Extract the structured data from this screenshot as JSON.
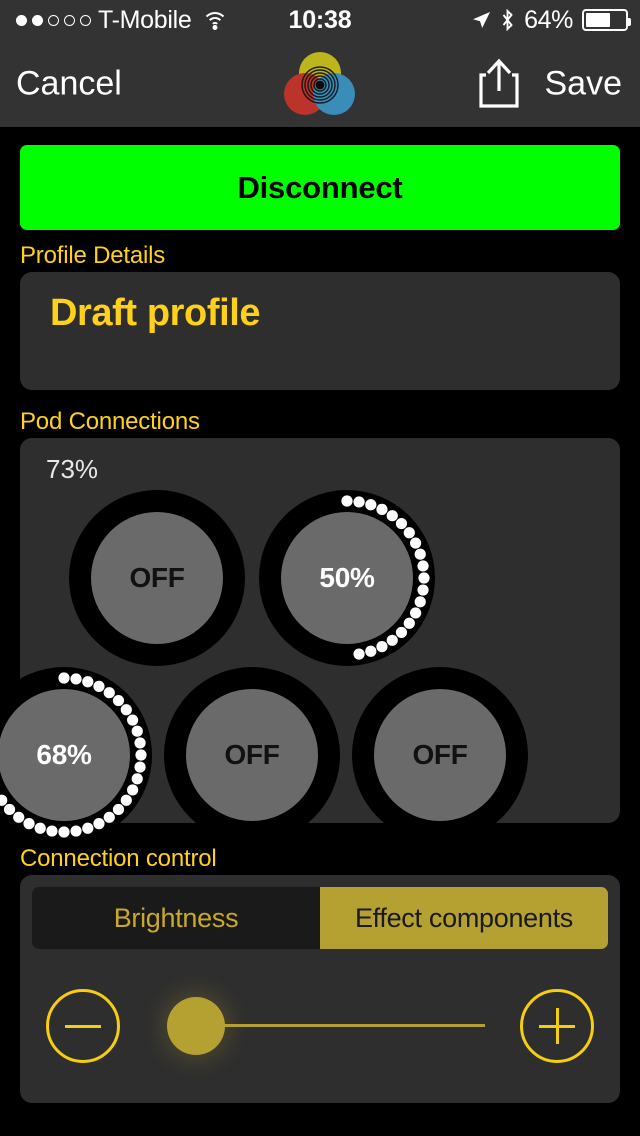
{
  "status_bar": {
    "signal_dots_filled": 2,
    "signal_dots_total": 5,
    "carrier": "T-Mobile",
    "wifi_icon": "wifi-icon",
    "time": "10:38",
    "location_icon": "location-arrow-icon",
    "bluetooth_icon": "bluetooth-icon",
    "battery_percent_label": "64%",
    "battery_level": 64
  },
  "nav": {
    "cancel_label": "Cancel",
    "save_label": "Save",
    "share_icon": "share-icon",
    "logo_icon": "app-logo-icon"
  },
  "main": {
    "disconnect_label": "Disconnect",
    "profile": {
      "section_label": "Profile Details",
      "name": "Draft profile"
    },
    "pods": {
      "section_label": "Pod Connections",
      "overall_percent_label": "73%",
      "dials": [
        {
          "name": "pod-dial-1",
          "label": "OFF",
          "value": 0,
          "on": false,
          "row": 0,
          "col": 0
        },
        {
          "name": "pod-dial-2",
          "label": "50%",
          "value": 50,
          "on": true,
          "row": 0,
          "col": 1
        },
        {
          "name": "pod-dial-3",
          "label": "68%",
          "value": 68,
          "on": true,
          "row": 1,
          "col": 0
        },
        {
          "name": "pod-dial-4",
          "label": "OFF",
          "value": 0,
          "on": false,
          "row": 1,
          "col": 1
        },
        {
          "name": "pod-dial-5",
          "label": "OFF",
          "value": 0,
          "on": false,
          "row": 1,
          "col": 2
        }
      ]
    },
    "connection_control": {
      "section_label": "Connection control",
      "tabs": [
        {
          "label": "Brightness",
          "selected": false
        },
        {
          "label": "Effect components",
          "selected": true
        }
      ],
      "decrement_icon": "minus-icon",
      "increment_icon": "plus-icon",
      "slider_value_percent": 5
    }
  },
  "colors": {
    "accent_gold": "#FFD11A",
    "segment_gold": "#B5A032",
    "button_green": "#00FF00",
    "panel_bg": "#2E2E2E",
    "page_bg": "#000000",
    "dial_knob": "#6A6A6A",
    "outline_gold": "#F5CE11"
  }
}
